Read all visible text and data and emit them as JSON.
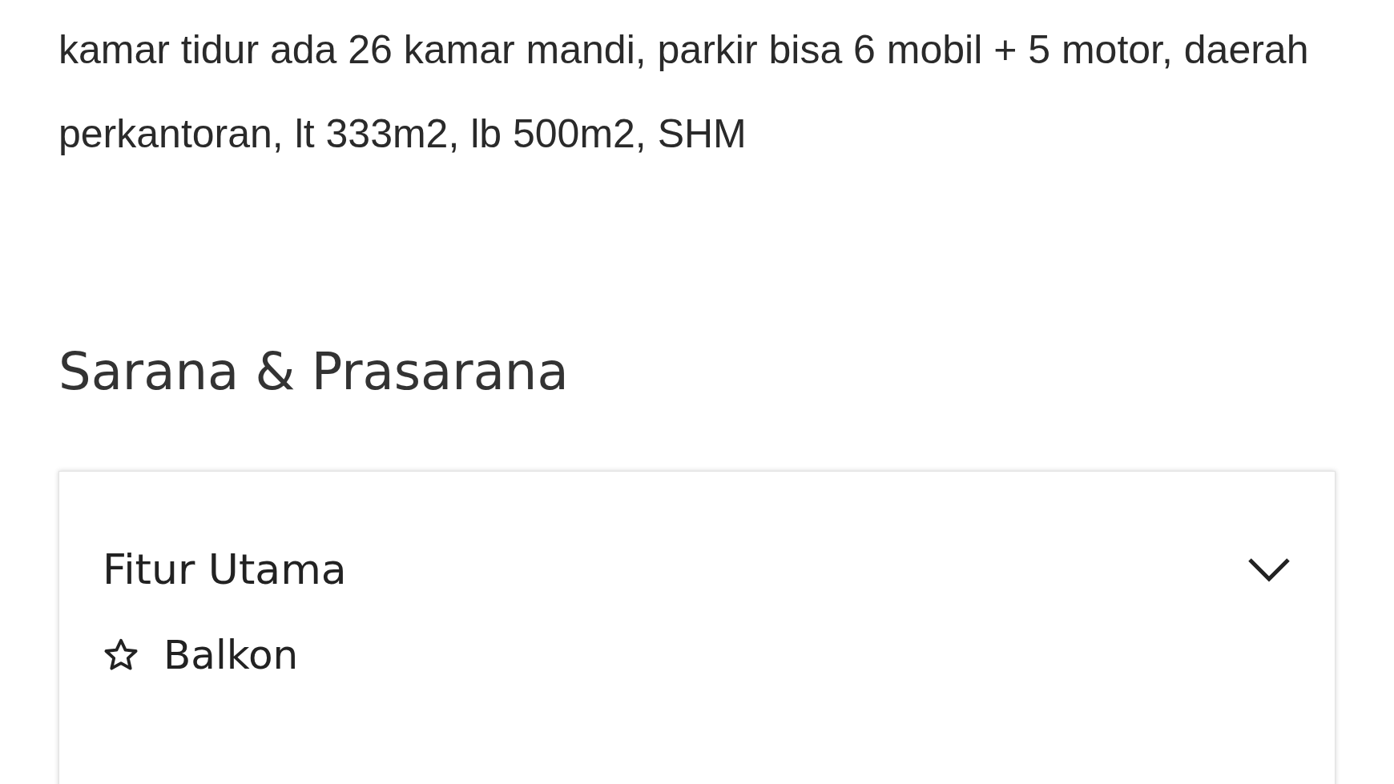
{
  "description": "kamar tidur ada 26 kamar mandi, parkir bisa 6 mobil + 5 motor, daerah perkantoran, lt 333m2, lb 500m2, SHM",
  "section_title": "Sarana & Prasarana",
  "accordion": {
    "title": "Fitur Utama",
    "expanded": true,
    "items": [
      {
        "label": "Balkon"
      }
    ]
  }
}
